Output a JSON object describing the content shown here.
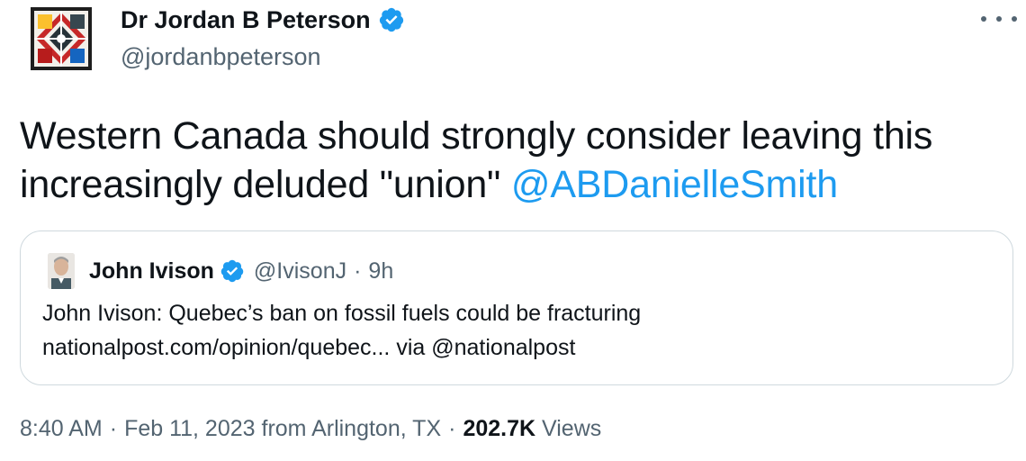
{
  "author": {
    "display_name": "Dr Jordan B Peterson",
    "handle": "@jordanbpeterson",
    "verified_icon": "verified-badge-icon",
    "avatar_icon": "profile-avatar"
  },
  "more_icon": "more-options-icon",
  "tweet": {
    "text": "Western Canada should strongly consider leaving this increasingly deluded \"union\" ",
    "mention": "@ABDanielleSmith"
  },
  "quote": {
    "name": "John Ivison",
    "handle": "@IvisonJ",
    "separator": "·",
    "time": "9h",
    "line1": "John Ivison: Quebec’s ban on fossil fuels could be fracturing",
    "line2": "nationalpost.com/opinion/quebec... via @nationalpost"
  },
  "meta": {
    "time": "8:40 AM",
    "separator": "·",
    "date": "Feb 11, 2023",
    "location": "from Arlington, TX",
    "views_count": "202.7K",
    "views_label": "Views"
  },
  "colors": {
    "accent": "#1d9bf0",
    "text": "#0f1419",
    "secondary": "#536471",
    "border": "#cfd9de"
  }
}
